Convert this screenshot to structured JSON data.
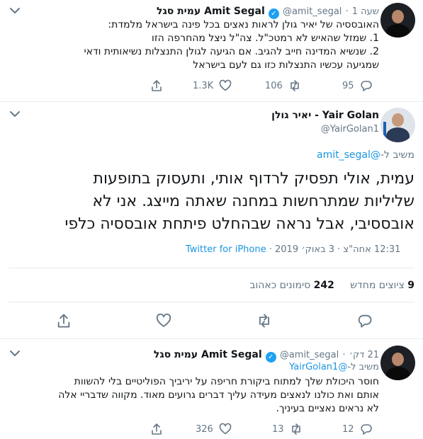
{
  "tweet1": {
    "author_name": "עמית סגל Amit Segal",
    "handle": "@amit_segal",
    "time": "שעה 1",
    "lines": [
      "האובססיה של יאיר גולן לראות נאצים בכל פינה בישראל מלמדת:",
      "1. שמזל שהאיש לא רמטכ\"ל. צה\"ל ניצל מהחרפה הזו",
      "2. שנשיא המדינה חייב להגיב. אם הגיעה לגולן התנצלות נשיאותית ודאי",
      "שמגיעה עכשיו התנצלות כזו גם לעם בישראל"
    ],
    "reply_count": "95",
    "retweet_count": "106",
    "like_count": "1.3K"
  },
  "main": {
    "author_name": "יאיר גולן - Yair Golan",
    "handle": "@YairGolan1",
    "replying_to_label": "משיב ל-",
    "replying_to_handle": "@amit_segal",
    "lines": [
      "עמית, אולי תפסיק לרדוף אותי, ותעסוק בתופעות",
      "שליליות שמתרחשות במחנה שאתה מייצג. אני לא",
      "אובססיבי, אבל נראה שבהחלט פיתחת אובססיה כלפי"
    ],
    "timestamp": "12:31 אחה\"צ · 3 באוק׳ 2019 ·",
    "source": "Twitter for iPhone",
    "quotes_count": "9",
    "quotes_label": "ציוצים מחדש",
    "likes_count": "242",
    "likes_label": "סימונים כאהוב"
  },
  "tweet3": {
    "author_name": "עמית סגל Amit Segal",
    "handle": "@amit_segal",
    "time": "21 דק׳",
    "replying_to_label": "משיב ל-",
    "replying_to_handle": "@YairGolan1",
    "lines": [
      "חוסר היכולת שלך למתוח ביקורת חריפה על יריביך הפוליטיים בלי להשוות",
      "אותם ואת כולנו לנאצים מעידה עליך דברים גרועים מאוד. מקווה שדבריי אלה",
      "לא נראים נאציים בעיניך."
    ],
    "reply_count": "12",
    "retweet_count": "13",
    "like_count": "326"
  },
  "colors": {
    "accent": "#1da1f2",
    "link": "#1b95e0",
    "muted": "#657786",
    "divider": "#e6ecf0"
  }
}
